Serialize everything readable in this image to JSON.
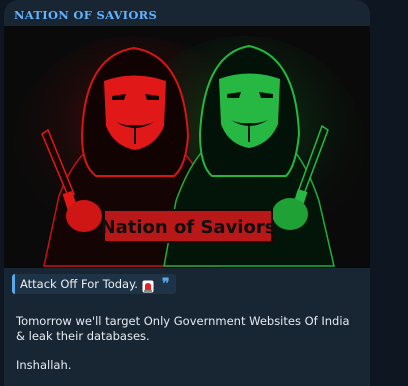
{
  "message": {
    "channel_name": "NATION OF SAVIORS",
    "banner_text": "Nation of Saviors",
    "quote": "Attack Off For Today.",
    "body_line": "Tomorrow we'll target  Only Government Websites Of India & leak their databases.",
    "closing": "Inshallah."
  },
  "colors": {
    "background": "#0e1621",
    "card": "#182533",
    "channel_name": "#63b3ff",
    "quote_accent": "#5aa8e8",
    "red_figure": "#e01818",
    "green_figure": "#1fae3a",
    "banner": "#b81818"
  },
  "icons": {
    "alarm": "alarm-light-icon",
    "quote": "quote-icon"
  }
}
